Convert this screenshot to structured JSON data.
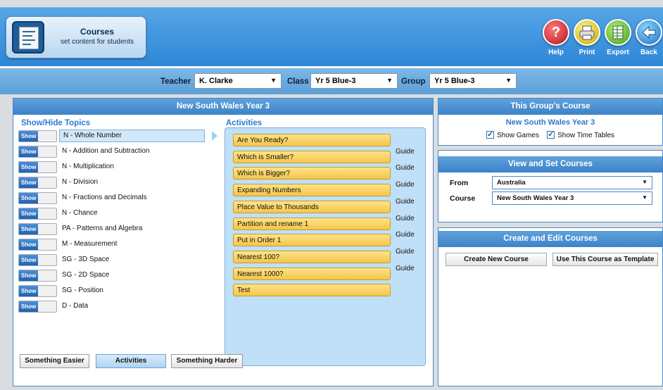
{
  "header": {
    "app_title": "Courses",
    "app_subtitle": "set content for students",
    "app_icon": "document-list-icon",
    "buttons": [
      {
        "label": "Help",
        "icon": "question-icon",
        "color": "#d42a2f"
      },
      {
        "label": "Print",
        "icon": "printer-icon",
        "color": "#e8c81c"
      },
      {
        "label": "Export",
        "icon": "spreadsheet-icon",
        "color": "#52b52a"
      },
      {
        "label": "Back",
        "icon": "back-arrow-icon",
        "color": "#2d8ae0"
      }
    ]
  },
  "filters": {
    "teacher_label": "Teacher",
    "teacher_value": "K. Clarke",
    "class_label": "Class",
    "class_value": "Yr 5 Blue-3",
    "group_label": "Group",
    "group_value": "Yr 5 Blue-3"
  },
  "course_panel": {
    "title": "New South Wales Year 3",
    "show_hide_label": "Show/Hide",
    "topics_label": "Topics",
    "activities_label": "Activities",
    "show_button_label": "Show",
    "topics": [
      "N -  Whole Number",
      "N - Addition and Subtraction",
      "N - Multiplication",
      "N - Division",
      "N - Fractions and Decimals",
      "N - Chance",
      "PA - Patterns and Algebra",
      "M - Measurement",
      "SG - 3D Space",
      "SG - 2D Space",
      "SG - Position",
      "D -  Data"
    ],
    "selected_topic": "N -  Whole Number",
    "activities": [
      {
        "name": "Are You Ready?",
        "guide": ""
      },
      {
        "name": "Which is Smaller?",
        "guide": "Guide"
      },
      {
        "name": "Which is Bigger?",
        "guide": "Guide"
      },
      {
        "name": "Expanding Numbers",
        "guide": "Guide"
      },
      {
        "name": "Place Value to Thousands",
        "guide": "Guide"
      },
      {
        "name": "Partition and rename 1",
        "guide": "Guide"
      },
      {
        "name": "Put in Order 1",
        "guide": "Guide"
      },
      {
        "name": "Nearest 100?",
        "guide": "Guide"
      },
      {
        "name": "Nearest 1000?",
        "guide": "Guide"
      },
      {
        "name": "Test",
        "guide": ""
      }
    ],
    "bottom_buttons": [
      "Something Easier",
      "Activities",
      "Something Harder"
    ],
    "active_bottom_button": "Activities"
  },
  "group_course": {
    "title": "This Group's Course",
    "course_name": "New South Wales Year 3",
    "show_games_label": "Show Games",
    "show_games_checked": true,
    "show_time_tables_label": "Show Time Tables",
    "show_time_tables_checked": true
  },
  "view_set": {
    "title": "View and Set Courses",
    "from_label": "From",
    "from_value": "Australia",
    "course_label": "Course",
    "course_value": "New South Wales Year 3"
  },
  "create_edit": {
    "title": "Create and Edit Courses",
    "create_button": "Create New Course",
    "template_button": "Use This Course as Template"
  },
  "colors": {
    "header_blue": "#3a8fd9",
    "panel_header": "#4a8fd2",
    "activity_yellow": "#f7cf5c",
    "topics_blue": "#2c7ad0"
  }
}
